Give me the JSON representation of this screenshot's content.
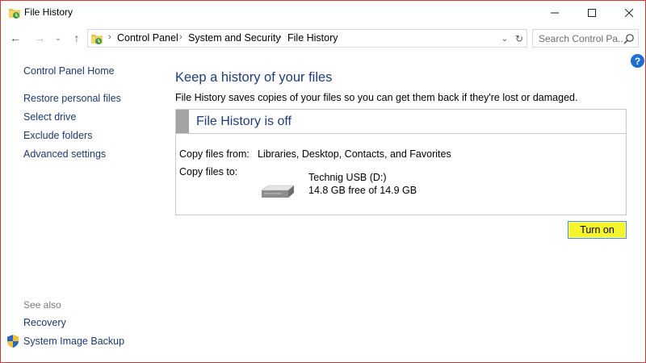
{
  "window": {
    "title": "File History",
    "controls": {
      "minimize": "–",
      "maximize": "☐",
      "close": "✕"
    }
  },
  "nav": {
    "back": "←",
    "forward": "→",
    "recent": "⌄",
    "up": "↑"
  },
  "address": {
    "sep1": "›",
    "crumb1": "Control Panel",
    "sep2": "›",
    "crumb2": "System and Security",
    "sep3": "›",
    "crumb3": "File History",
    "dropdown": "⌄",
    "refresh": "↻"
  },
  "search": {
    "placeholder": "Search Control Pa..."
  },
  "help": "?",
  "sidebar": {
    "home": "Control Panel Home",
    "items": [
      "Restore personal files",
      "Select drive",
      "Exclude folders",
      "Advanced settings"
    ],
    "see_also": "See also",
    "see_also_items": [
      "Recovery",
      "System Image Backup"
    ]
  },
  "main": {
    "heading": "Keep a history of your files",
    "description": "File History saves copies of your files so you can get them back if they're lost or damaged.",
    "status_title": "File History is off",
    "copy_from_label": "Copy files from:",
    "copy_from_value": "Libraries, Desktop, Contacts, and Favorites",
    "copy_to_label": "Copy files to:",
    "drive_name": "Technig USB (D:)",
    "drive_space": "14.8 GB free of 14.9 GB",
    "turn_on": "Turn on"
  },
  "colors": {
    "link": "#1c3a6e",
    "heading": "#1e3d7a",
    "turn_on_highlight": "#f6f52b",
    "window_border": "#d23a3a"
  }
}
